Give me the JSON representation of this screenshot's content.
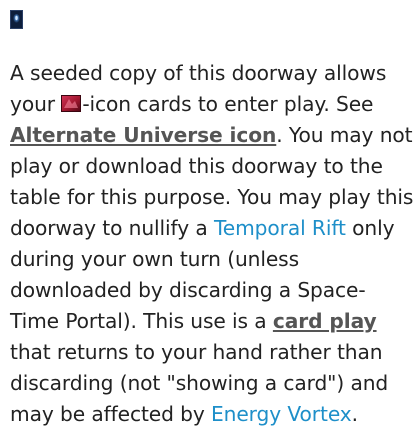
{
  "colors": {
    "text": "#222222",
    "link_blue": "#1e8fc9",
    "link_bold": "#555555",
    "icon_dark": "#0d1e3c",
    "icon_glow": "#5f9edb",
    "inline_icon_red": "#a0162f"
  },
  "icons": {
    "top": "doorway-card-icon",
    "inline": "alternate-universe-icon"
  },
  "text": {
    "p1": "A seeded copy of this doorway allows your ",
    "p2": "-icon cards to enter play. See ",
    "link_alt": "Alternate Universe icon",
    "p3": ". You may not play or download this doorway to the table for this purpose. You may play this doorway to nullify a ",
    "link_rift": "Temporal Rift",
    "p4": " only during your own turn (unless downloaded by discarding a Space- Time Portal). This use is a ",
    "link_cardplay": "card play",
    "p5": " that returns to your hand rather than discarding (not \"showing a card\") and may be affected by ",
    "link_vortex": "Energy Vortex",
    "p6": "."
  }
}
